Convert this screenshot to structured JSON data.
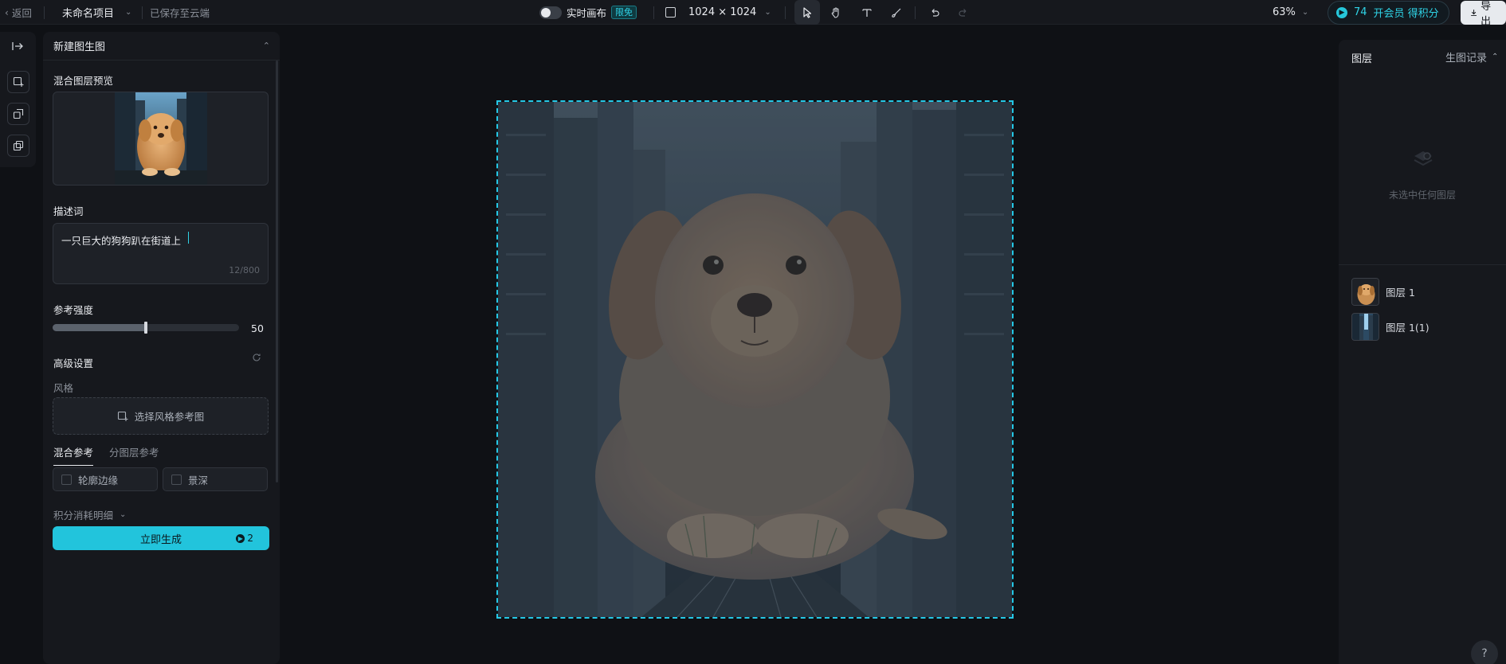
{
  "topbar": {
    "back": "返回",
    "project_name": "未命名项目",
    "save_status": "已保存至云端",
    "realtime_label": "实时画布",
    "free_badge": "限免",
    "canvas_size": "1024 × 1024",
    "zoom": "63%",
    "credits": "74",
    "membership": "开会员 得积分",
    "export": "导出"
  },
  "left_panel": {
    "title": "新建图生图",
    "preview_label": "混合图层预览",
    "prompt_label": "描述词",
    "prompt_value": "一只巨大的狗狗趴在街道上",
    "prompt_count": "12/800",
    "strength_label": "参考强度",
    "strength_value": "50",
    "advanced_label": "高级设置",
    "style_label": "风格",
    "style_button": "选择风格参考图",
    "tabs": [
      "混合参考",
      "分图层参考"
    ],
    "checkboxes": [
      "轮廓边缘",
      "景深"
    ],
    "cost_detail": "积分消耗明细",
    "generate": "立即生成",
    "generate_cost": "2"
  },
  "right_panel": {
    "tab_layers": "图层",
    "tab_history": "生图记录",
    "empty_text": "未选中任何图层",
    "layers": [
      "图层 1",
      "图层 1(1)"
    ]
  },
  "help": "?",
  "colors": {
    "accent": "#22c4dc",
    "selection": "#24c8e6",
    "background": "#0f1115",
    "panel": "#16181d"
  }
}
